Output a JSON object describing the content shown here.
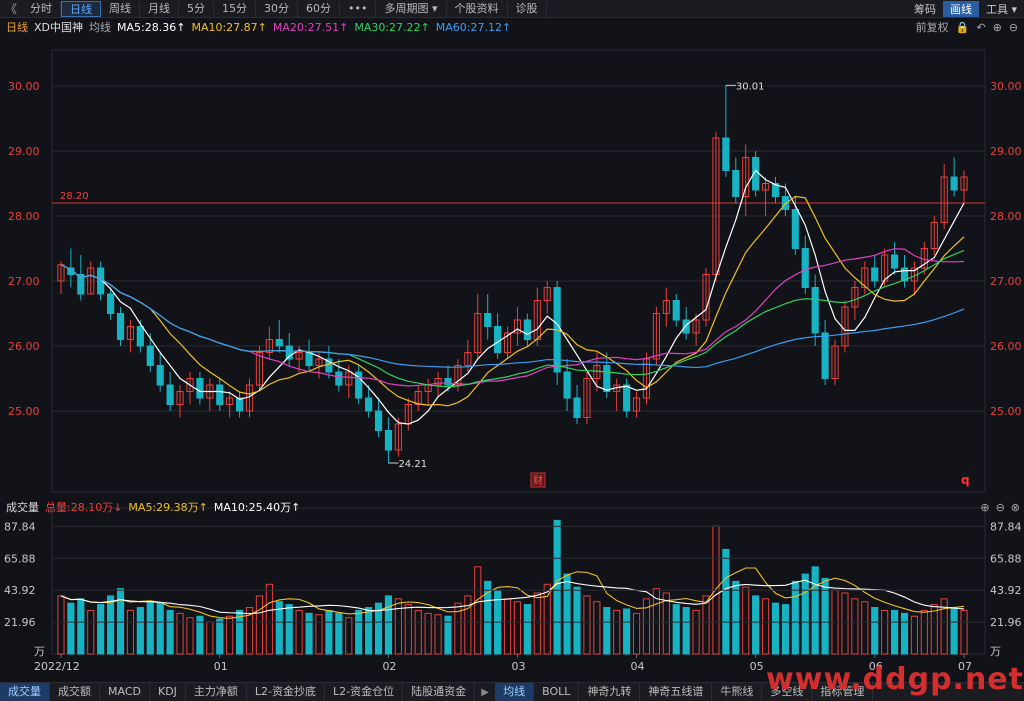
{
  "toolbar": {
    "back": "《",
    "tabs": [
      "分时",
      "日线",
      "周线",
      "月线",
      "5分",
      "15分",
      "30分",
      "60分",
      "•••",
      "多周期图 ▾",
      "个股资料",
      "诊股"
    ],
    "active_index": 1,
    "right": [
      "筹码",
      "画线",
      "工具 ▾"
    ]
  },
  "ma_header": {
    "period": "日线",
    "name": "XD中国神",
    "type": "均线",
    "ma5": "MA5:28.36↑",
    "ma10": "MA10:27.87↑",
    "ma20": "MA20:27.51↑",
    "ma30": "MA30:27.22↑",
    "ma60": "MA60:27.12↑",
    "adjust": "前复权",
    "colors": {
      "ma5": "#ffffff",
      "ma10": "#f0c020",
      "ma20": "#e040c0",
      "ma30": "#30d060",
      "ma60": "#3c9cf0"
    }
  },
  "price_axis": {
    "labels": [
      "30.00",
      "29.00",
      "28.00",
      "27.00",
      "26.00",
      "25.00"
    ],
    "hline_label": "28.20",
    "high_mark": "30.01",
    "low_mark": "24.21",
    "finance_badge": "财",
    "q_badge": "q"
  },
  "volume_header": {
    "title": "成交量",
    "total": "总量:28.10万↓",
    "ma5": "MA5:29.38万↑",
    "ma10": "MA10:25.40万↑"
  },
  "volume_axis": {
    "labels": [
      "87.84",
      "65.88",
      "43.92",
      "21.96"
    ],
    "unit": "万"
  },
  "x_axis": {
    "labels": [
      "2022/12",
      "01",
      "02",
      "03",
      "04",
      "05",
      "06",
      "07"
    ]
  },
  "bottom_tabs": [
    "成交量",
    "成交额",
    "MACD",
    "KDJ",
    "主力净额",
    "L2-资金抄底",
    "L2-资金仓位",
    "陆股通资金",
    "▶",
    "均线",
    "BOLL",
    "神奇九转",
    "神奇五线谱",
    "牛熊线",
    "多空线",
    "指标管理"
  ],
  "bottom_active": [
    0,
    9
  ],
  "watermark": "www.ddgp.net",
  "colors": {
    "up": "#e8403a",
    "down": "#17b3c3",
    "grid": "#2a2b33",
    "hline": "#d83838",
    "bg": "#121319"
  },
  "chart_data": {
    "type": "candlestick",
    "y_range": [
      24.0,
      30.4
    ],
    "volume_range": [
      0,
      95
    ],
    "candles": [
      [
        27.0,
        27.3,
        26.8,
        27.25,
        40
      ],
      [
        27.2,
        27.5,
        26.9,
        27.1,
        35
      ],
      [
        27.1,
        27.4,
        26.7,
        26.8,
        38
      ],
      [
        26.8,
        27.3,
        26.8,
        27.2,
        30
      ],
      [
        27.2,
        27.3,
        26.7,
        26.8,
        34
      ],
      [
        26.8,
        26.9,
        26.4,
        26.5,
        40
      ],
      [
        26.5,
        26.6,
        26.0,
        26.1,
        45
      ],
      [
        26.1,
        26.4,
        25.9,
        26.3,
        30
      ],
      [
        26.3,
        26.4,
        25.9,
        26.0,
        32
      ],
      [
        26.0,
        26.2,
        25.6,
        25.7,
        36
      ],
      [
        25.7,
        25.9,
        25.3,
        25.4,
        35
      ],
      [
        25.4,
        25.6,
        25.0,
        25.1,
        30
      ],
      [
        25.1,
        25.4,
        24.9,
        25.3,
        28
      ],
      [
        25.3,
        25.6,
        25.1,
        25.5,
        25
      ],
      [
        25.5,
        25.6,
        25.1,
        25.2,
        26
      ],
      [
        25.2,
        25.5,
        25.0,
        25.4,
        22
      ],
      [
        25.4,
        25.5,
        25.0,
        25.1,
        24
      ],
      [
        25.1,
        25.3,
        24.9,
        25.2,
        26
      ],
      [
        25.2,
        25.3,
        24.9,
        25.0,
        30
      ],
      [
        25.0,
        25.5,
        24.9,
        25.4,
        32
      ],
      [
        25.4,
        26.0,
        25.3,
        25.9,
        40
      ],
      [
        25.9,
        26.3,
        25.8,
        26.1,
        48
      ],
      [
        26.1,
        26.4,
        25.9,
        26.0,
        36
      ],
      [
        26.0,
        26.2,
        25.7,
        25.8,
        34
      ],
      [
        25.8,
        26.0,
        25.6,
        25.9,
        30
      ],
      [
        25.9,
        26.1,
        25.6,
        25.7,
        28
      ],
      [
        25.7,
        25.9,
        25.5,
        25.8,
        27
      ],
      [
        25.8,
        26.0,
        25.5,
        25.6,
        30
      ],
      [
        25.6,
        25.8,
        25.3,
        25.4,
        28
      ],
      [
        25.4,
        25.7,
        25.2,
        25.6,
        25
      ],
      [
        25.6,
        25.7,
        25.1,
        25.2,
        30
      ],
      [
        25.2,
        25.4,
        24.9,
        25.0,
        32
      ],
      [
        25.0,
        25.2,
        24.6,
        24.7,
        35
      ],
      [
        24.7,
        24.9,
        24.2,
        24.4,
        40
      ],
      [
        24.4,
        24.9,
        24.3,
        24.8,
        38
      ],
      [
        24.8,
        25.2,
        24.7,
        25.1,
        34
      ],
      [
        25.1,
        25.4,
        25.0,
        25.3,
        30
      ],
      [
        25.3,
        25.5,
        25.1,
        25.4,
        28
      ],
      [
        25.4,
        25.6,
        25.2,
        25.5,
        27
      ],
      [
        25.5,
        25.7,
        25.3,
        25.4,
        26
      ],
      [
        25.4,
        25.8,
        25.3,
        25.7,
        35
      ],
      [
        25.7,
        26.1,
        25.6,
        25.9,
        40
      ],
      [
        25.9,
        26.8,
        25.8,
        26.5,
        60
      ],
      [
        26.5,
        26.8,
        26.1,
        26.3,
        50
      ],
      [
        26.3,
        26.5,
        25.8,
        25.9,
        44
      ],
      [
        25.9,
        26.3,
        25.8,
        26.2,
        38
      ],
      [
        26.2,
        26.6,
        26.0,
        26.4,
        36
      ],
      [
        26.4,
        26.5,
        26.0,
        26.1,
        34
      ],
      [
        26.1,
        26.9,
        26.0,
        26.7,
        42
      ],
      [
        26.7,
        27.0,
        26.5,
        26.9,
        48
      ],
      [
        26.9,
        27.0,
        25.4,
        25.6,
        92
      ],
      [
        25.6,
        25.8,
        25.0,
        25.2,
        55
      ],
      [
        25.2,
        25.4,
        24.8,
        24.9,
        46
      ],
      [
        24.9,
        25.6,
        24.8,
        25.5,
        40
      ],
      [
        25.5,
        25.9,
        25.3,
        25.7,
        36
      ],
      [
        25.7,
        25.9,
        25.2,
        25.3,
        32
      ],
      [
        25.3,
        25.5,
        25.0,
        25.4,
        30
      ],
      [
        25.4,
        25.5,
        24.9,
        25.0,
        31
      ],
      [
        25.0,
        25.3,
        24.9,
        25.2,
        28
      ],
      [
        25.2,
        25.9,
        25.1,
        25.8,
        38
      ],
      [
        25.8,
        26.6,
        25.7,
        26.5,
        45
      ],
      [
        26.5,
        26.9,
        26.3,
        26.7,
        42
      ],
      [
        26.7,
        26.8,
        26.3,
        26.4,
        34
      ],
      [
        26.4,
        26.6,
        26.1,
        26.2,
        32
      ],
      [
        26.2,
        26.5,
        26.0,
        26.4,
        30
      ],
      [
        26.4,
        27.2,
        26.3,
        27.1,
        40
      ],
      [
        27.1,
        29.3,
        27.0,
        29.2,
        88
      ],
      [
        29.2,
        30.01,
        28.6,
        28.7,
        72
      ],
      [
        28.7,
        28.9,
        28.2,
        28.3,
        50
      ],
      [
        28.3,
        29.1,
        28.0,
        28.9,
        46
      ],
      [
        28.9,
        29.0,
        28.3,
        28.4,
        40
      ],
      [
        28.4,
        28.6,
        28.0,
        28.5,
        38
      ],
      [
        28.5,
        28.6,
        28.2,
        28.3,
        35
      ],
      [
        28.3,
        28.5,
        28.0,
        28.1,
        34
      ],
      [
        28.1,
        28.3,
        27.4,
        27.5,
        50
      ],
      [
        27.5,
        27.7,
        26.8,
        26.9,
        55
      ],
      [
        26.9,
        27.1,
        26.0,
        26.2,
        60
      ],
      [
        26.2,
        26.4,
        25.4,
        25.5,
        52
      ],
      [
        25.5,
        26.1,
        25.4,
        26.0,
        44
      ],
      [
        26.0,
        26.7,
        25.9,
        26.6,
        42
      ],
      [
        26.6,
        27.0,
        26.4,
        26.9,
        38
      ],
      [
        26.9,
        27.3,
        26.8,
        27.2,
        36
      ],
      [
        27.2,
        27.4,
        26.9,
        27.0,
        32
      ],
      [
        27.0,
        27.5,
        26.9,
        27.4,
        30
      ],
      [
        27.4,
        27.6,
        27.1,
        27.2,
        30
      ],
      [
        27.2,
        27.4,
        26.9,
        27.0,
        28
      ],
      [
        27.0,
        27.3,
        26.8,
        27.2,
        26
      ],
      [
        27.2,
        27.6,
        27.1,
        27.5,
        30
      ],
      [
        27.5,
        28.0,
        27.4,
        27.9,
        34
      ],
      [
        27.9,
        28.8,
        27.8,
        28.6,
        38
      ],
      [
        28.6,
        28.9,
        28.3,
        28.4,
        32
      ],
      [
        28.4,
        28.7,
        28.2,
        28.6,
        30
      ]
    ]
  }
}
